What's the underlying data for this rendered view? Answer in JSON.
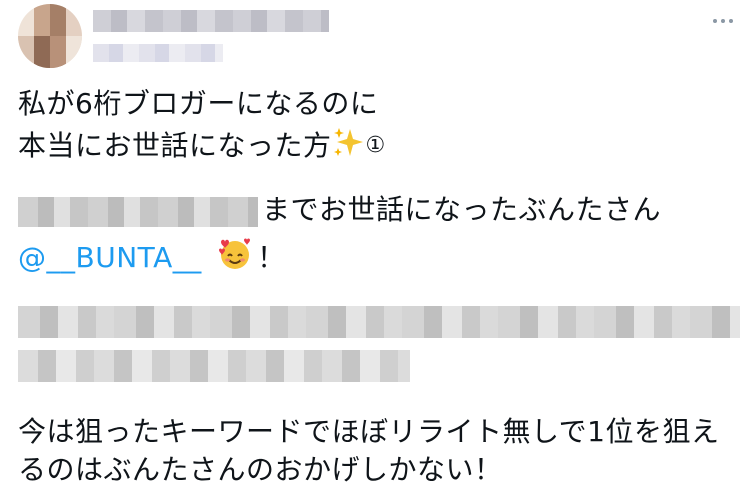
{
  "tweet": {
    "line1": "私が6桁ブロガーになるのに",
    "line2_text": "本当にお世話になった方",
    "line2_num": "①",
    "line3_text": "までお世話になったぶんたさん",
    "mention": "@__BUNTA__",
    "exclaim": "！",
    "line5": "今は狙ったキーワードでほぼリライト無しで1位を狙え",
    "line6": "るのはぶんたさんのおかげしかない！"
  },
  "icons": {
    "more": "more-horizontal-icon",
    "sparkles": "sparkles-emoji",
    "smiling_face": "smiling-face-with-hearts-emoji"
  },
  "colors": {
    "link": "#1d9bf0",
    "text": "#0f1419"
  }
}
